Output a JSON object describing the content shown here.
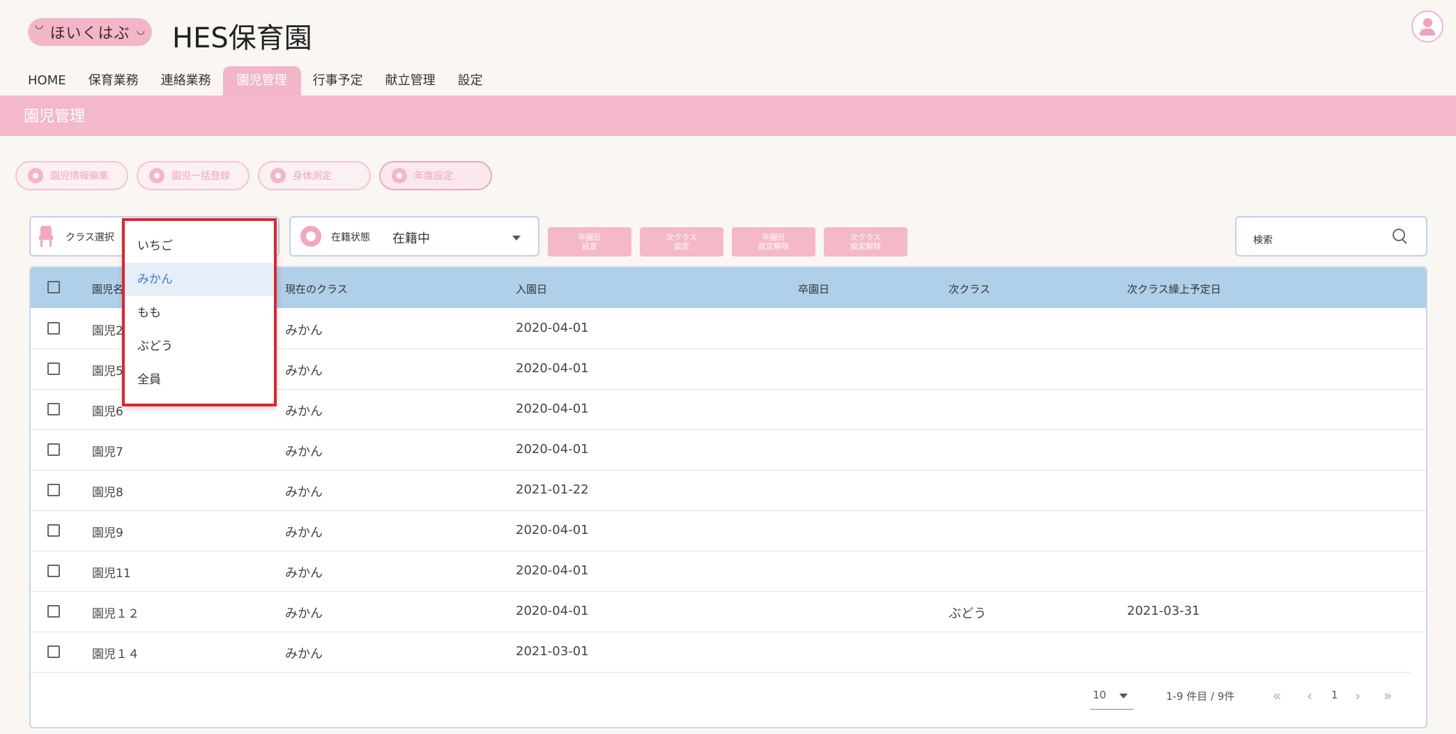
{
  "header": {
    "logo_text": "ほいくはぶ",
    "org_name": "HES保育園"
  },
  "nav": {
    "items": [
      "HOME",
      "保育業務",
      "連絡業務",
      "園児管理",
      "行事予定",
      "献立管理",
      "設定"
    ],
    "active": "園児管理"
  },
  "section": {
    "title": "園児管理"
  },
  "actions": [
    "園児情報編集",
    "園児一括登録",
    "身体測定",
    "年度設定"
  ],
  "filters": {
    "class_label": "クラス選択",
    "status_label": "在籍状態",
    "status_value": "在籍中",
    "buttons": [
      "卒園日\n設定",
      "次クラス\n設定",
      "卒園日\n設定解除",
      "次クラス\n設定解除"
    ],
    "search_label": "検索"
  },
  "dropdown": {
    "options": [
      "いちご",
      "みかん",
      "もも",
      "ぶどう",
      "全員"
    ],
    "selected": "みかん"
  },
  "table": {
    "columns": [
      "園児名",
      "現在のクラス",
      "入園日",
      "卒園日",
      "次クラス",
      "次クラス繰上予定日"
    ],
    "rows": [
      {
        "name": "園児2",
        "class": "みかん",
        "entry": "2020-04-01",
        "grad": "",
        "next_class": "",
        "next_date": ""
      },
      {
        "name": "園児5",
        "class": "みかん",
        "entry": "2020-04-01",
        "grad": "",
        "next_class": "",
        "next_date": ""
      },
      {
        "name": "園児6",
        "class": "みかん",
        "entry": "2020-04-01",
        "grad": "",
        "next_class": "",
        "next_date": ""
      },
      {
        "name": "園児7",
        "class": "みかん",
        "entry": "2020-04-01",
        "grad": "",
        "next_class": "",
        "next_date": ""
      },
      {
        "name": "園児8",
        "class": "みかん",
        "entry": "2021-01-22",
        "grad": "",
        "next_class": "",
        "next_date": ""
      },
      {
        "name": "園児9",
        "class": "みかん",
        "entry": "2020-04-01",
        "grad": "",
        "next_class": "",
        "next_date": ""
      },
      {
        "name": "園児11",
        "class": "みかん",
        "entry": "2020-04-01",
        "grad": "",
        "next_class": "",
        "next_date": ""
      },
      {
        "name": "園児１２",
        "class": "みかん",
        "entry": "2020-04-01",
        "grad": "",
        "next_class": "ぶどう",
        "next_date": "2021-03-31"
      },
      {
        "name": "園児１４",
        "class": "みかん",
        "entry": "2021-03-01",
        "grad": "",
        "next_class": "",
        "next_date": ""
      }
    ]
  },
  "pagination": {
    "per_page": "10",
    "range": "1-9 件目 / 9件",
    "current_page": "1"
  },
  "colors": {
    "brand_pink": "#f3b6c8",
    "table_header": "#b0cfe8",
    "highlight_red": "#e0232c"
  }
}
